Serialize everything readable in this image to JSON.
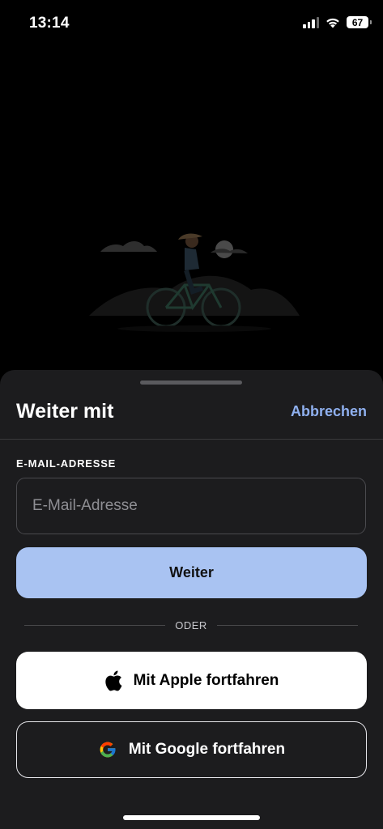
{
  "status_bar": {
    "time": "13:14",
    "battery": "67",
    "icons": [
      "signal-icon",
      "wifi-icon",
      "battery-icon"
    ]
  },
  "illustration": {
    "icon": "cyclist-illustration"
  },
  "sheet": {
    "title": "Weiter mit",
    "cancel_label": "Abbrechen",
    "email": {
      "label": "E-MAIL-ADRESSE",
      "placeholder": "E-Mail-Adresse",
      "value": ""
    },
    "continue_label": "Weiter",
    "or_label": "ODER",
    "apple": {
      "label": "Mit Apple fortfahren",
      "icon": "apple-icon"
    },
    "google": {
      "label": "Mit Google fortfahren",
      "icon": "google-icon"
    }
  },
  "colors": {
    "background": "#000000",
    "sheet": "#1c1c1e",
    "accent": "#8fb0ef",
    "primary_button": "#a9c3f2"
  }
}
